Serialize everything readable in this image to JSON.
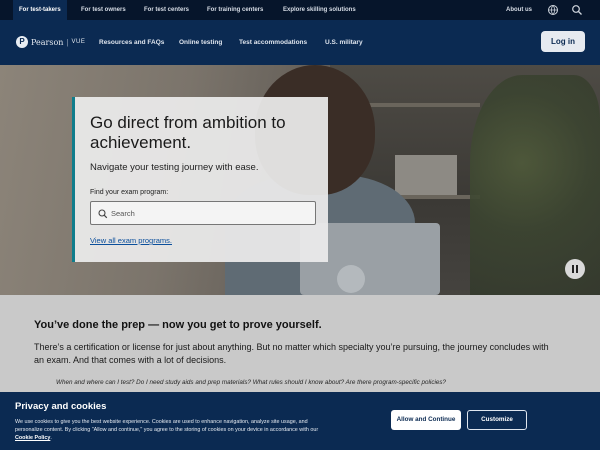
{
  "topbar": {
    "tabs": [
      {
        "label": "For test-takers",
        "active": true
      },
      {
        "label": "For test owners",
        "active": false
      },
      {
        "label": "For test centers",
        "active": false
      },
      {
        "label": "For training centers",
        "active": false
      },
      {
        "label": "Explore skilling solutions",
        "active": false
      }
    ],
    "about_label": "About us",
    "icons": [
      "globe-icon",
      "search-icon"
    ]
  },
  "mainnav": {
    "logo_text": "Pearson",
    "logo_mark": "P",
    "logo_suffix": "VUE",
    "links": [
      "Resources and FAQs",
      "Online testing",
      "Test accommodations",
      "U.S. military"
    ],
    "login_label": "Log in"
  },
  "hero": {
    "title": "Go direct from ambition to achievement.",
    "subtitle": "Navigate your testing journey with ease.",
    "search_label": "Find your exam program:",
    "search_placeholder": "Search",
    "all_programs_link": "View all exam programs.",
    "pause_icon": "pause-icon"
  },
  "content": {
    "title": "You’ve done the prep — now you get to prove yourself.",
    "body": "There’s a certification or license for just about anything. But no matter which specialty you’re pursuing, the journey concludes with an exam. And that comes with a lot of decisions.",
    "questions": "When and where can I test? Do I need study aids and prep materials? What rules should I know about? Are there program-specific policies?"
  },
  "cookie": {
    "title": "Privacy and cookies",
    "text": "We use cookies to give you the best website experience. Cookies are used to enhance navigation, analyze site usage, and personalize content. By clicking \"Allow and continue,\" you agree to the storing of cookies on your device in accordance with our",
    "policy_link": "Cookie Policy",
    "policy_end": ".",
    "accept_label": "Allow and Continue",
    "customize_label": "Customize"
  },
  "colors": {
    "navy": "#0b2a52",
    "topbar": "#06152b",
    "accent_teal": "#0f7d8c",
    "link": "#0b4f9c"
  }
}
